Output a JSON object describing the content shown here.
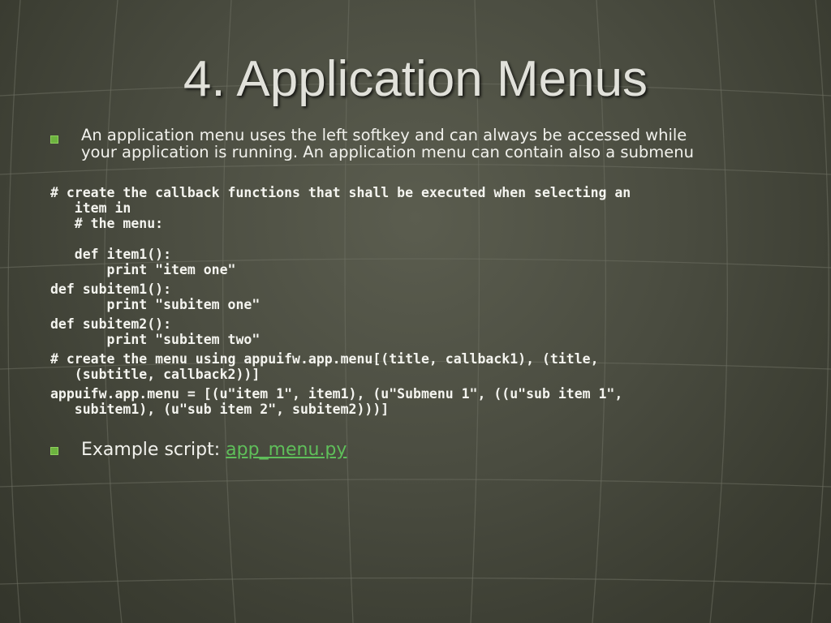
{
  "slide": {
    "title": "4. Application Menus",
    "bullet1_line1": "An application menu uses the left softkey and can always be accessed while",
    "bullet1_line2": "your application is running. An application menu can contain also a submenu",
    "code": [
      "# create the callback functions that shall be executed when selecting an",
      "   item in",
      "   # the menu:",
      "",
      "   def item1():",
      "       print \"item one\"",
      "def subitem1():",
      "       print \"subitem one\"",
      "def subitem2():",
      "       print \"subitem two\"",
      "# create the menu using appuifw.app.menu[(title, callback1), (title,",
      "   (subtitle, callback2))]",
      "appuifw.app.menu = [(u\"item 1\", item1), (u\"Submenu 1\", ((u\"sub item 1\",",
      "   subitem1), (u\"sub item 2\", subitem2)))]"
    ],
    "example_prefix": "Example script: ",
    "example_link": "app_menu.py"
  },
  "colors": {
    "bullet": "#6db33f",
    "link": "#5fbf5a",
    "title": "#e1e1da",
    "text": "#f1f1ec"
  }
}
